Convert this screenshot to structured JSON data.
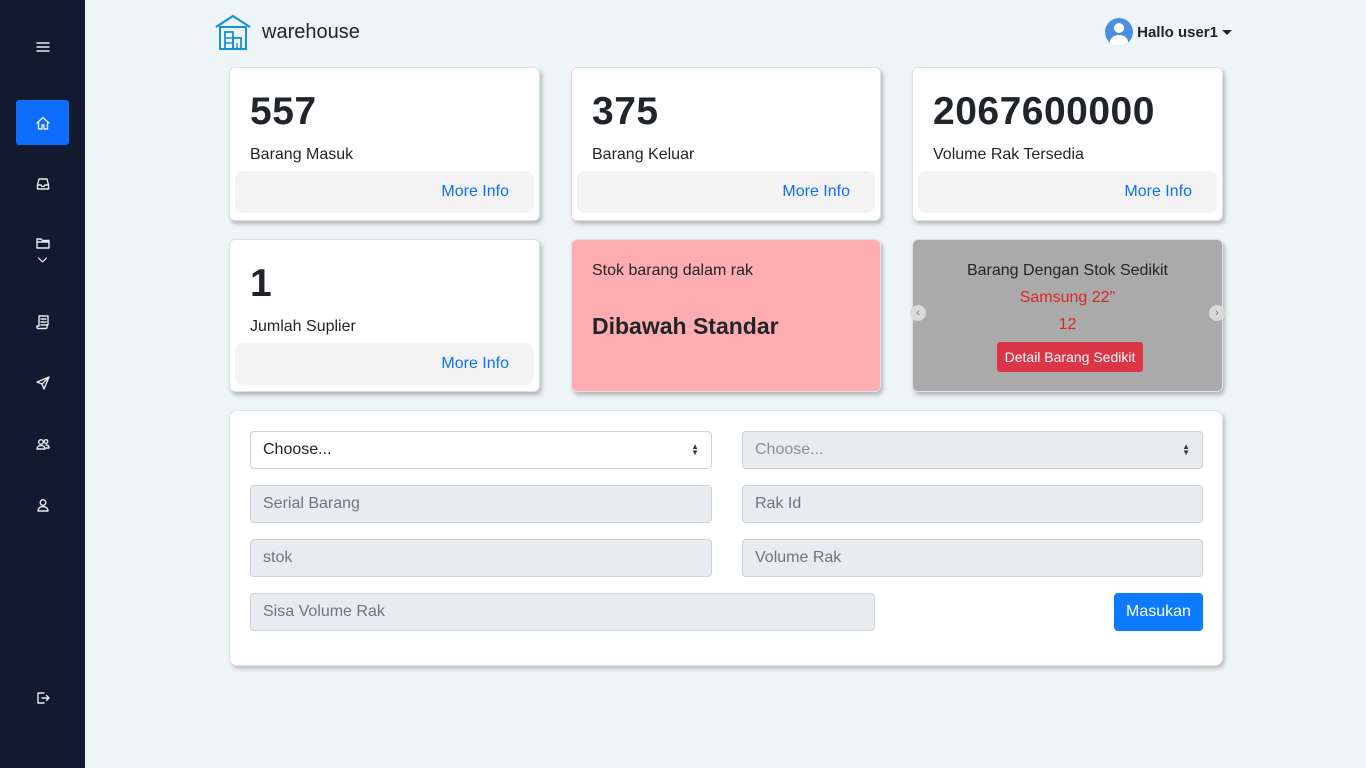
{
  "app": {
    "name": "warehouse"
  },
  "user": {
    "greeting": "Hallo user1"
  },
  "sidebar": {
    "items": [
      {
        "icon": "menu-icon"
      },
      {
        "icon": "home-icon",
        "active": true
      },
      {
        "icon": "inbox-icon"
      },
      {
        "icon": "folder-icon"
      },
      {
        "icon": "receipt-icon"
      },
      {
        "icon": "send-icon"
      },
      {
        "icon": "users-icon"
      },
      {
        "icon": "user-icon"
      },
      {
        "icon": "logout-icon"
      }
    ]
  },
  "stats": [
    {
      "value": "557",
      "label": "Barang Masuk",
      "link": "More Info"
    },
    {
      "value": "375",
      "label": "Barang Keluar",
      "link": "More Info"
    },
    {
      "value": "2067600000",
      "label": "Volume Rak Tersedia",
      "link": "More Info"
    },
    {
      "value": "1",
      "label": "Jumlah Suplier",
      "link": "More Info"
    }
  ],
  "stock_status": {
    "label": "Stok barang dalam rak",
    "status": "Dibawah Standar",
    "color": "#ffadb0"
  },
  "low_stock": {
    "title": "Barang Dengan Stok Sedikit",
    "item": "Samsung 22\"",
    "count": "12",
    "button": "Detail Barang Sedikit"
  },
  "form": {
    "select1": "Choose...",
    "select2": "Choose...",
    "serial_placeholder": "Serial Barang",
    "rak_id_placeholder": "Rak Id",
    "stok_placeholder": "stok",
    "volume_rak_placeholder": "Volume Rak",
    "sisa_volume_placeholder": "Sisa Volume Rak",
    "submit": "Masukan"
  },
  "colors": {
    "sidebar": "#111a2e",
    "primary": "#0d6efd",
    "danger": "#dc3545",
    "background": "#eef5f6"
  }
}
